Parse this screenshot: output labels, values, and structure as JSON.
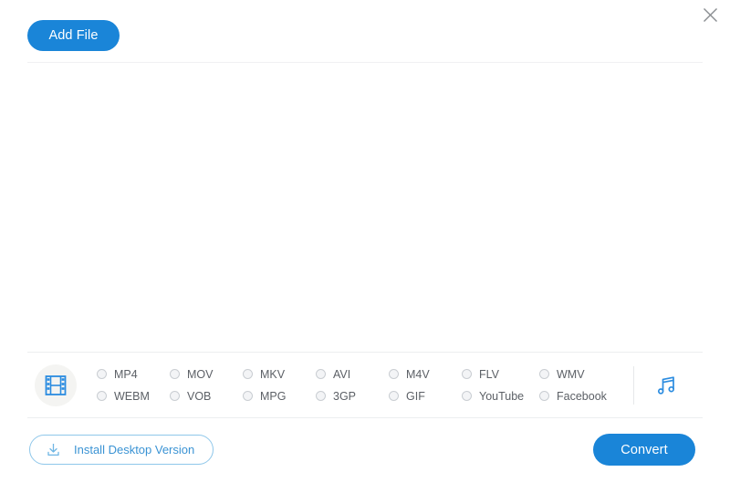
{
  "window": {
    "close_icon": "close-icon"
  },
  "toolbar": {
    "add_file_label": "Add File"
  },
  "formats": {
    "video_icon": "film-strip-icon",
    "audio_icon": "music-note-icon",
    "options": [
      {
        "label": "MP4",
        "selected": false
      },
      {
        "label": "MOV",
        "selected": false
      },
      {
        "label": "MKV",
        "selected": false
      },
      {
        "label": "AVI",
        "selected": false
      },
      {
        "label": "M4V",
        "selected": false
      },
      {
        "label": "FLV",
        "selected": false
      },
      {
        "label": "WMV",
        "selected": false
      },
      {
        "label": "WEBM",
        "selected": false
      },
      {
        "label": "VOB",
        "selected": false
      },
      {
        "label": "MPG",
        "selected": false
      },
      {
        "label": "3GP",
        "selected": false
      },
      {
        "label": "GIF",
        "selected": false
      },
      {
        "label": "YouTube",
        "selected": false
      },
      {
        "label": "Facebook",
        "selected": false
      }
    ]
  },
  "footer": {
    "install_label": "Install Desktop Version",
    "install_icon": "download-icon",
    "convert_label": "Convert"
  },
  "colors": {
    "accent_blue": "#1a85d8",
    "link_blue": "#3a93d4",
    "outline_blue": "#8fc7ea",
    "icon_blue": "#2b8ce0",
    "label_gray": "#5c6066",
    "divider": "#eceef0"
  }
}
